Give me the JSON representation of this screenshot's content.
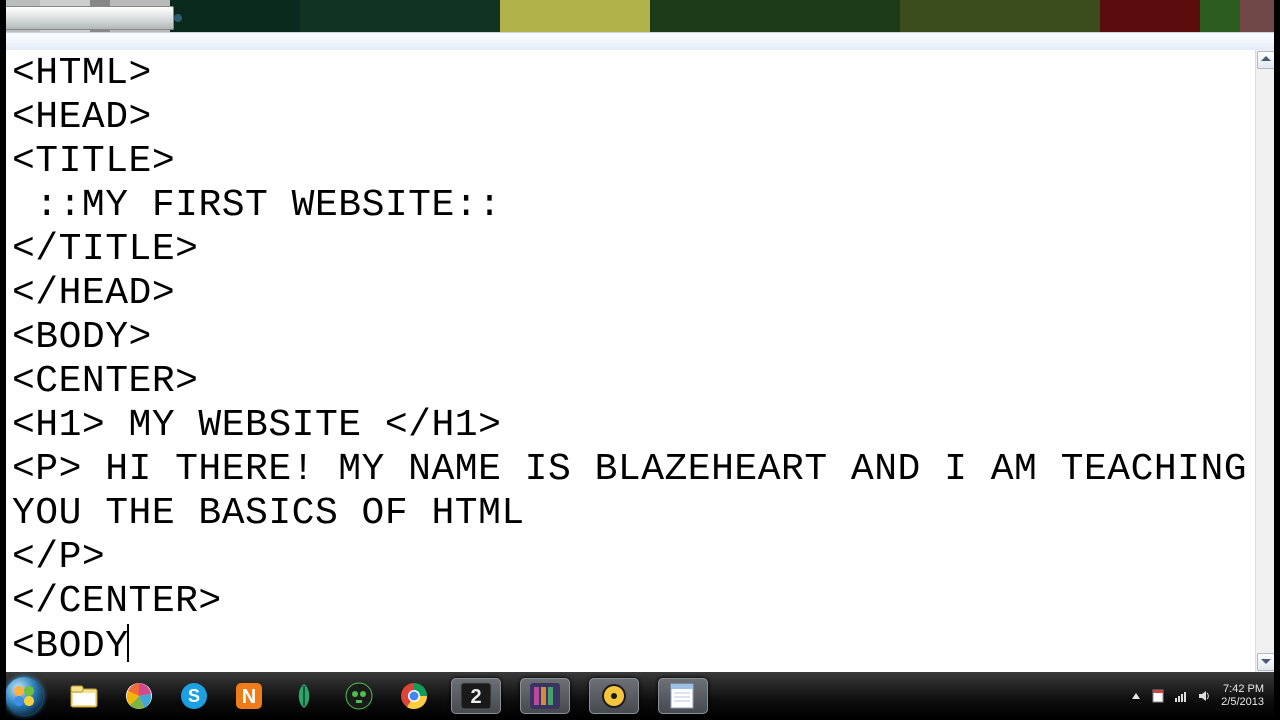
{
  "editor": {
    "lines": [
      "<HTML>",
      "<HEAD>",
      "<TITLE>",
      " ::MY FIRST WEBSITE::",
      "</TITLE>",
      "</HEAD>",
      "<BODY>",
      "<CENTER>",
      "<H1> MY WEBSITE </H1>",
      "<P> HI THERE! MY NAME IS BLAZEHEART AND I AM TEACHING YOU THE BASICS OF HTML",
      "</P>",
      "</CENTER>",
      "<BODY"
    ]
  },
  "taskbar": {
    "icons": [
      {
        "name": "explorer",
        "glyph": "explorer"
      },
      {
        "name": "picasa",
        "glyph": "picasa"
      },
      {
        "name": "skype",
        "glyph": "skype"
      },
      {
        "name": "nimbuzz",
        "glyph": "N"
      },
      {
        "name": "leaf-app",
        "glyph": "leaf"
      },
      {
        "name": "skull-app",
        "glyph": "skull"
      },
      {
        "name": "chrome",
        "glyph": "chrome"
      },
      {
        "name": "app-2",
        "glyph": "2",
        "active": true
      },
      {
        "name": "app-mixer",
        "glyph": "mixer",
        "active": true
      },
      {
        "name": "app-disc",
        "glyph": "disc",
        "active": true
      },
      {
        "name": "notepad",
        "glyph": "notepad",
        "active": true
      }
    ]
  },
  "tray": {
    "time": "7:42 PM",
    "date": "2/5/2013"
  }
}
